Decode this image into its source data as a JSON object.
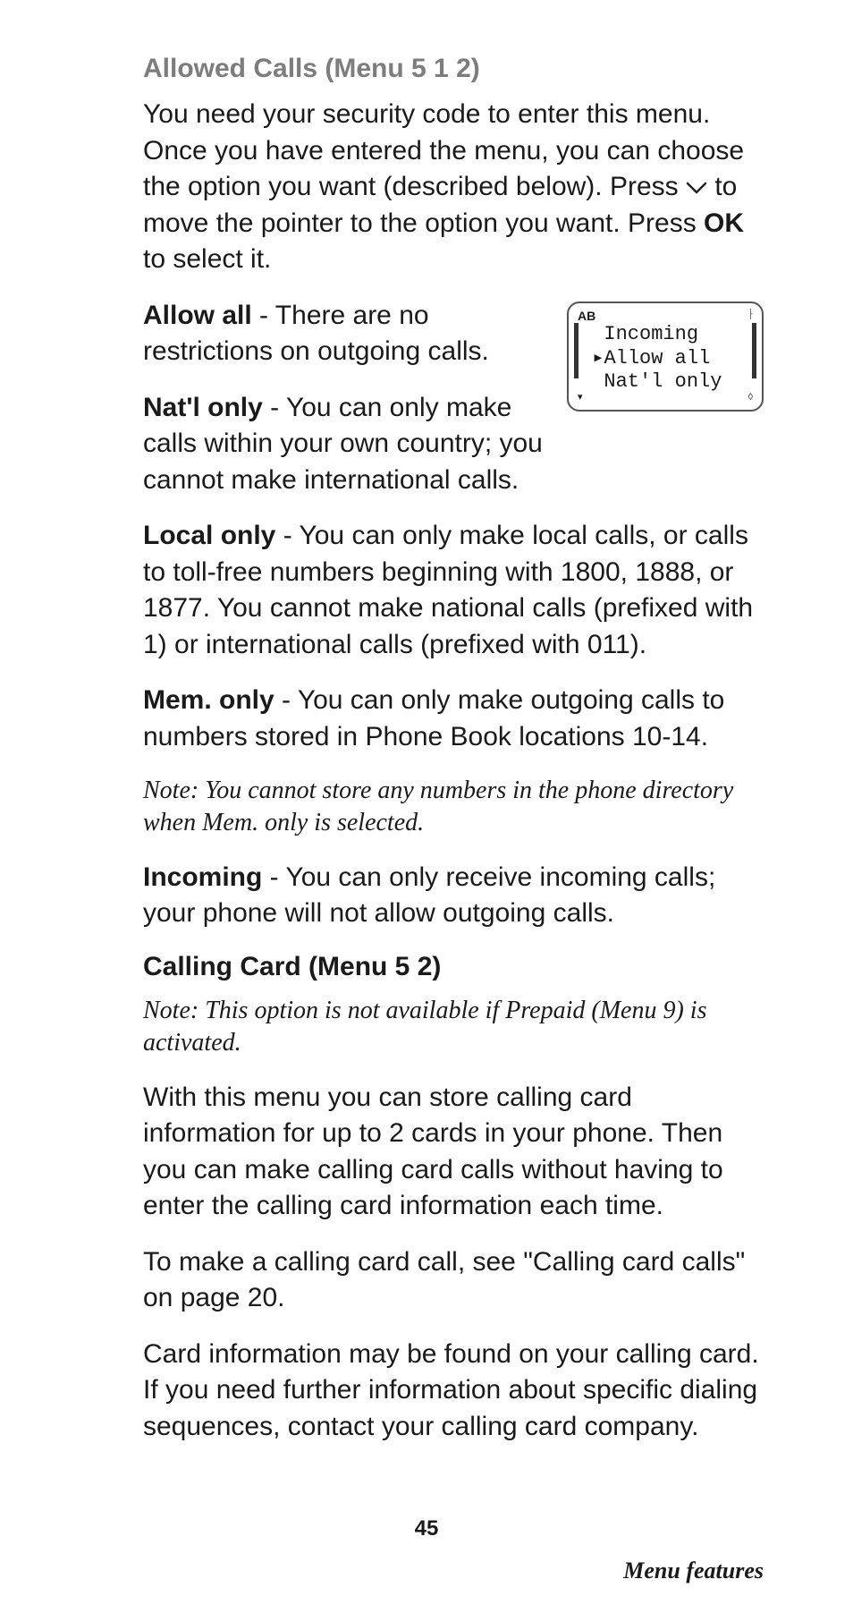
{
  "heading1": "Allowed Calls (Menu 5 1 2)",
  "p_intro_1": "You need your security code to enter this menu. Once you have entered the menu, you can choose the option you want (described below). Press ",
  "p_intro_2": " to move the pointer to the option you want. Press ",
  "p_intro_ok": "OK",
  "p_intro_3": " to select it.",
  "allow_all_label": "Allow all",
  "allow_all_text": " - There are no restrictions on outgoing calls.",
  "natl_label": "Nat'l only",
  "natl_text": " - You can only make calls within your own country; you cannot make international calls.",
  "local_label": "Local only",
  "local_text": " - You can only make local calls, or calls to toll-free numbers beginning with 1800, 1888, or 1877. You cannot make national calls (prefixed with 1) or international calls (prefixed with 011).",
  "mem_label": "Mem. only",
  "mem_text": " - You can only make outgoing calls to numbers stored in Phone Book locations 10-14.",
  "mem_note": "Note: You cannot store any numbers in the phone directory when Mem. only is selected.",
  "incoming_label": "Incoming",
  "incoming_text": " - You can only receive incoming calls; your phone will not allow outgoing calls.",
  "heading2": "Calling Card (Menu 5 2)",
  "cc_note": "Note: This option is not available if  Prepaid (Menu 9) is activated.",
  "cc_p1": "With this menu you can store calling card information for up to 2 cards in your phone. Then you can make calling card calls without having to enter the calling card information each time.",
  "cc_p2": "To make a calling card call, see \"Calling card calls\" on page 20.",
  "cc_p3": "Card information may be found on your calling card. If you need further information about specific dialing sequences, contact your calling card company.",
  "page_number": "45",
  "footer": "Menu features",
  "lcd": {
    "ab": "AB",
    "line1": "  Incoming",
    "line2": " ▸Allow all",
    "line3": "  Nat'l only",
    "foot_left": "▾",
    "foot_right": "◊"
  }
}
